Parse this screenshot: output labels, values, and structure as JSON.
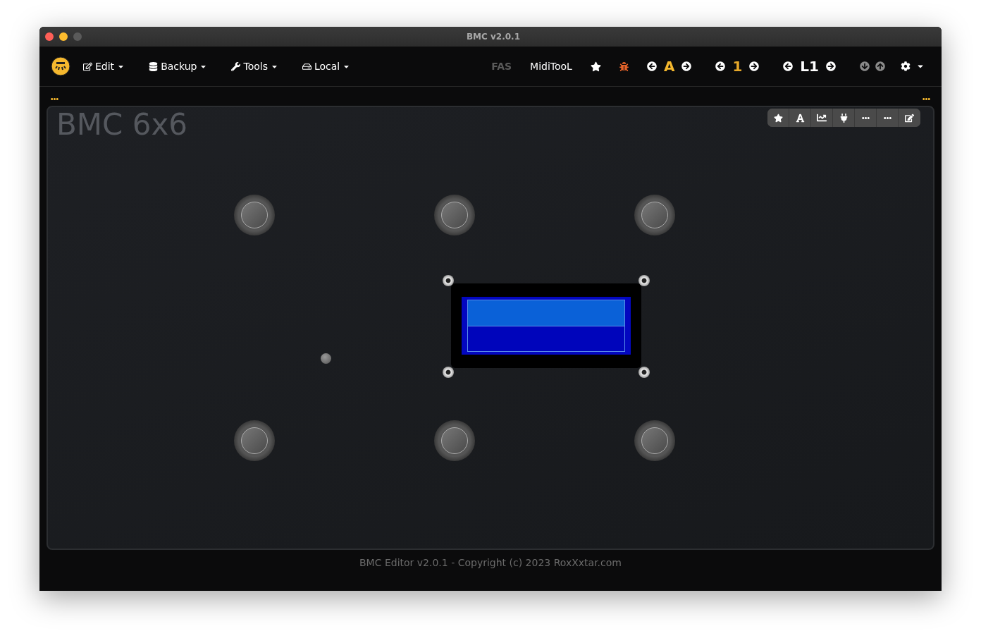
{
  "window": {
    "title": "BMC v2.0.1"
  },
  "menus": [
    {
      "label": "Edit"
    },
    {
      "label": "Backup"
    },
    {
      "label": "Tools"
    },
    {
      "label": "Local"
    }
  ],
  "links": [
    {
      "label": "FAS",
      "disabled": true
    },
    {
      "label": "MidiTooL",
      "disabled": false
    }
  ],
  "selectors": [
    {
      "value": "A",
      "color": "#f5b82e"
    },
    {
      "value": "1",
      "color": "#e6a82a"
    },
    {
      "value": "L1",
      "color": "#ffffff"
    }
  ],
  "sync": {
    "disabled": true
  },
  "panel": {
    "title": "BMC 6x6"
  },
  "footer": "BMC Editor v2.0.1 - Copyright (c) 2023 RoxXxtar.com"
}
